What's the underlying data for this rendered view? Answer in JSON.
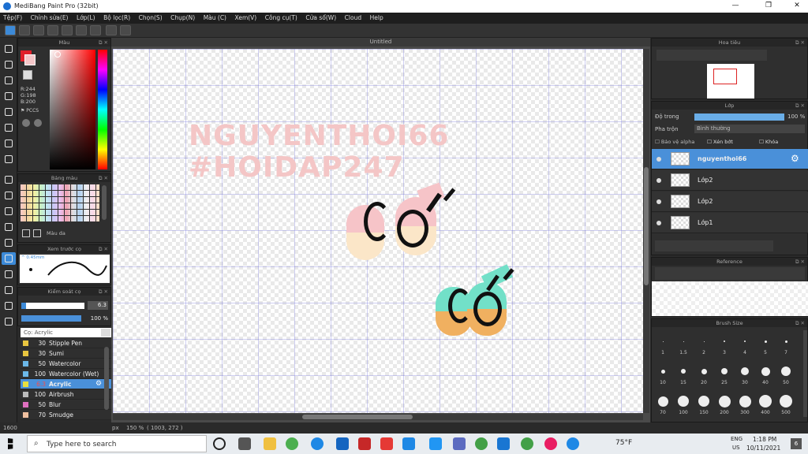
{
  "window": {
    "title": "MediBang Paint Pro (32bit)",
    "min": "—",
    "max": "❐",
    "close": "✕"
  },
  "menu": [
    "Tệp(F)",
    "Chỉnh sửa(E)",
    "Lớp(L)",
    "Bộ lọc(R)",
    "Chọn(S)",
    "Chụp(N)",
    "Màu (C)",
    "Xem(V)",
    "Công cụ(T)",
    "Cửa sổ(W)",
    "Cloud",
    "Help"
  ],
  "color_panel": {
    "title": "Màu",
    "r": "R:244",
    "g": "G:198",
    "b": "B:200",
    "pcs": "PCCS",
    "fg": "#f4c6c8",
    "bg": "#e0202a"
  },
  "palette_panel": {
    "title": "Bảng màu",
    "label": "Màu da"
  },
  "brush_preview": {
    "title": "Xem trước cọ",
    "size": "0.45mm"
  },
  "brush_control": {
    "title": "Kiểm soát cọ",
    "size": "6.3",
    "opacity": "100 %"
  },
  "brush_list": {
    "header": "Cọ: Acrylic",
    "items": [
      {
        "size": "30",
        "name": "Stipple Pen",
        "color": "#e8c540"
      },
      {
        "size": "30",
        "name": "Sumi",
        "color": "#e8c540"
      },
      {
        "size": "50",
        "name": "Watercolor",
        "color": "#6cb8e8"
      },
      {
        "size": "100",
        "name": "Watercolor (Wet)",
        "color": "#6cb8e8"
      },
      {
        "size": "6.3",
        "name": "Acrylic",
        "color": "#e8e040"
      },
      {
        "size": "100",
        "name": "Airbrush",
        "color": "#bbbbbb"
      },
      {
        "size": "50",
        "name": "Blur",
        "color": "#e070c0"
      },
      {
        "size": "70",
        "name": "Smudge",
        "color": "#f0c0a0"
      }
    ]
  },
  "canvas": {
    "tab": "Untitled",
    "watermark1": "NGUYENTHOI66",
    "watermark2": "#HOIDAP247",
    "glyph": "cố"
  },
  "navigator": {
    "title": "Hoa tiêu"
  },
  "layer_panel": {
    "title": "Lớp",
    "opacity_label": "Độ trong",
    "opacity_value": "100 %",
    "blend_label": "Pha trộn",
    "blend_value": "Bình thường",
    "protect_alpha": "Bảo vệ alpha",
    "clipping": "Xén bớt",
    "lock": "Khóa",
    "layers": [
      "nguyenthoi66",
      "Lớp2",
      "Lớp2",
      "Lớp1"
    ]
  },
  "reference_panel": {
    "title": "Reference"
  },
  "brush_size_panel": {
    "title": "Brush Size",
    "labels_row1": [
      "1",
      "1.5",
      "2",
      "3",
      "4",
      "5",
      "7"
    ],
    "labels_row2": [
      "10",
      "15",
      "20",
      "25",
      "30",
      "40",
      "50"
    ],
    "labels_row3": [
      "70",
      "100",
      "150",
      "200",
      "300",
      "400",
      "500"
    ]
  },
  "status": {
    "zoom_left": "1600",
    "px": "px",
    "zoom": "150 %",
    "coords": "( 1003, 272 )"
  },
  "taskbar": {
    "search_placeholder": "Type here to search",
    "weather": "75°F",
    "lang1": "ENG",
    "lang2": "US",
    "time": "1:18 PM",
    "date": "10/11/2021",
    "notif": "6"
  }
}
